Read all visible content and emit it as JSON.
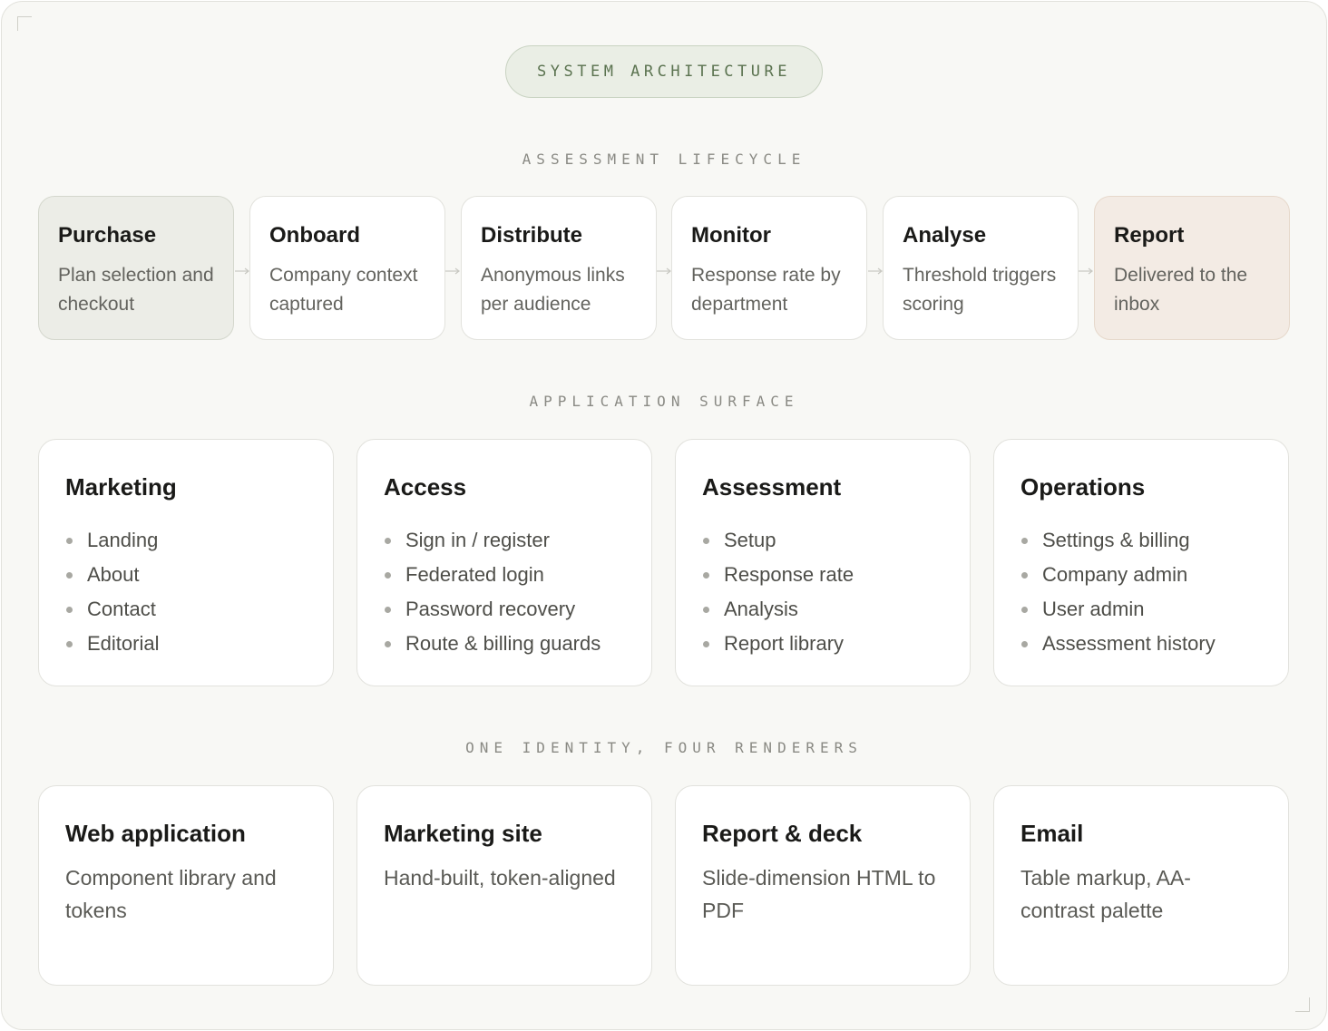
{
  "header": {
    "badge": "SYSTEM ARCHITECTURE"
  },
  "lifecycle": {
    "label": "ASSESSMENT LIFECYCLE",
    "steps": [
      {
        "title": "Purchase",
        "desc": "Plan selection and checkout"
      },
      {
        "title": "Onboard",
        "desc": "Company context captured"
      },
      {
        "title": "Distribute",
        "desc": "Anonymous links per audience"
      },
      {
        "title": "Monitor",
        "desc": "Response rate by department"
      },
      {
        "title": "Analyse",
        "desc": "Threshold triggers scoring"
      },
      {
        "title": "Report",
        "desc": "Delivered to the inbox"
      }
    ]
  },
  "surface": {
    "label": "APPLICATION SURFACE",
    "groups": [
      {
        "title": "Marketing",
        "items": [
          "Landing",
          "About",
          "Contact",
          "Editorial"
        ]
      },
      {
        "title": "Access",
        "items": [
          "Sign in / register",
          "Federated login",
          "Password recovery",
          "Route & billing guards"
        ]
      },
      {
        "title": "Assessment",
        "items": [
          "Setup",
          "Response rate",
          "Analysis",
          "Report library"
        ]
      },
      {
        "title": "Operations",
        "items": [
          "Settings & billing",
          "Company admin",
          "User admin",
          "Assessment history"
        ]
      }
    ]
  },
  "renderers": {
    "label": "ONE IDENTITY, FOUR RENDERERS",
    "items": [
      {
        "title": "Web application",
        "desc": "Component library and tokens"
      },
      {
        "title": "Marketing site",
        "desc": "Hand-built, token-aligned"
      },
      {
        "title": "Report & deck",
        "desc": "Slide-dimension HTML to PDF"
      },
      {
        "title": "Email",
        "desc": "Table markup, AA-contrast palette"
      }
    ]
  }
}
